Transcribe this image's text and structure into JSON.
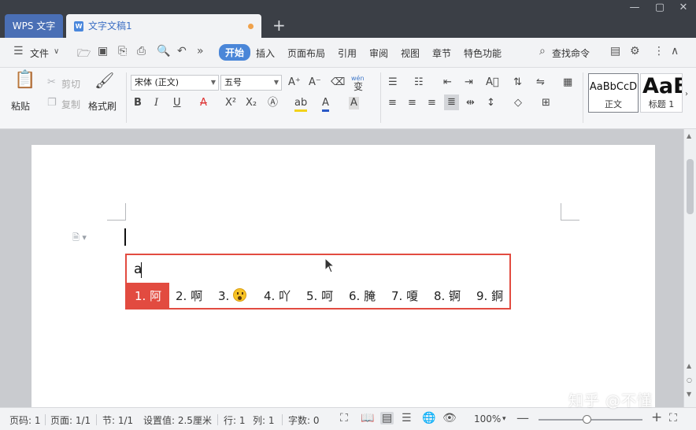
{
  "titlebar": {
    "app_tab": "WPS 文字",
    "doc_tab": "文字文稿1",
    "new_tab": "+",
    "minimize": "—",
    "maximize": "▢",
    "close": "✕"
  },
  "menubar": {
    "file": "文件",
    "tabs": [
      "开始",
      "插入",
      "页面布局",
      "引用",
      "审阅",
      "视图",
      "章节",
      "特色功能"
    ],
    "active_tab": "开始",
    "search": "查找命令"
  },
  "ribbon": {
    "paste": "粘贴",
    "cut": "剪切",
    "copy": "复制",
    "format_painter": "格式刷",
    "font_name": "宋体 (正文)",
    "font_size": "五号",
    "phonetic_top": "wén",
    "phonetic_bottom": "变",
    "style_normal_sample": "AaBbCcD",
    "style_normal": "正文",
    "style_heading_sample": "AaB",
    "style_heading": "标题 1"
  },
  "ime": {
    "input": "a",
    "candidates": [
      "1. 阿",
      "2. 啊",
      "3.",
      "4. 吖",
      "5. 呵",
      "6. 腌",
      "7. 嗄",
      "8. 锕",
      "9. 錒"
    ]
  },
  "statusbar": {
    "page_code": "页码: 1",
    "pages": "页面: 1/1",
    "section": "节: 1/1",
    "setting": "设置值: 2.5厘米",
    "row": "行: 1",
    "col": "列: 1",
    "word_count": "字数: 0",
    "zoom": "100%",
    "zoom_level": 100
  },
  "watermark": "知乎 @不懂",
  "colors": {
    "accent": "#4a86d8",
    "ime_border": "#e24b40",
    "titlebar": "#3b3f46"
  }
}
